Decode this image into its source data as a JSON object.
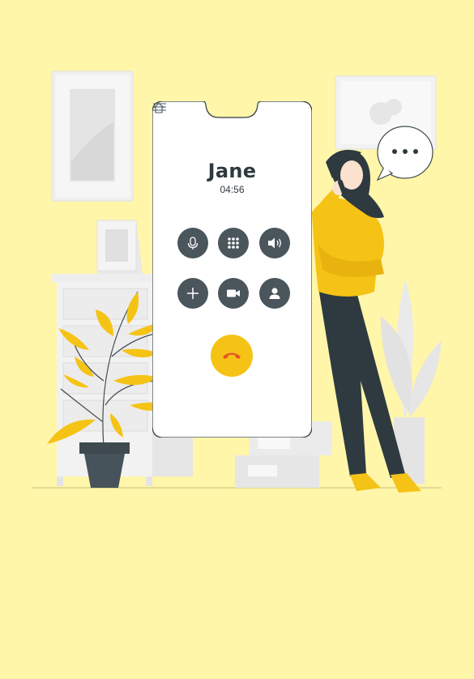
{
  "call": {
    "caller_name": "Jane",
    "duration": "04:56"
  },
  "controls": [
    {
      "icon": "microphone-icon"
    },
    {
      "icon": "keypad-icon"
    },
    {
      "icon": "speaker-icon"
    },
    {
      "icon": "add-call-icon"
    },
    {
      "icon": "video-icon"
    },
    {
      "icon": "contact-icon"
    }
  ],
  "end_call": {
    "icon": "hang-up-icon"
  },
  "colors": {
    "background": "#FFF6AA",
    "accent": "#F5C315",
    "control": "#4A555C",
    "dark": "#2E3A40"
  }
}
